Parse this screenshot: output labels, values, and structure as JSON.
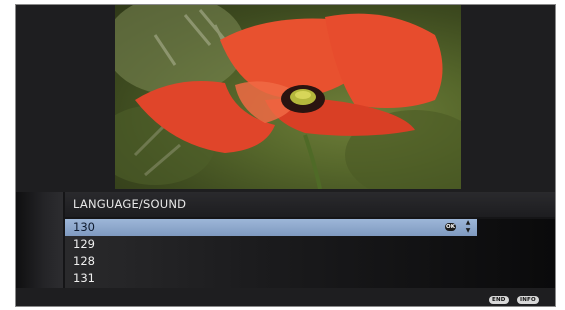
{
  "menu": {
    "title": "LANGUAGE/SOUND",
    "items": [
      {
        "label": "130",
        "selected": true
      },
      {
        "label": "129",
        "selected": false
      },
      {
        "label": "128",
        "selected": false
      },
      {
        "label": "131",
        "selected": false
      }
    ],
    "ok_label": "OK",
    "updown_glyph": "▲▼"
  },
  "footer": {
    "end_label": "END",
    "info_label": "INFO"
  },
  "colors": {
    "selection": "#8ea8cc",
    "panel": "#151517",
    "frame": "#1e1e20"
  },
  "icons": {
    "video": "poppy-flower-image",
    "ok": "ok-button-icon",
    "updown": "up-down-arrows-icon"
  }
}
